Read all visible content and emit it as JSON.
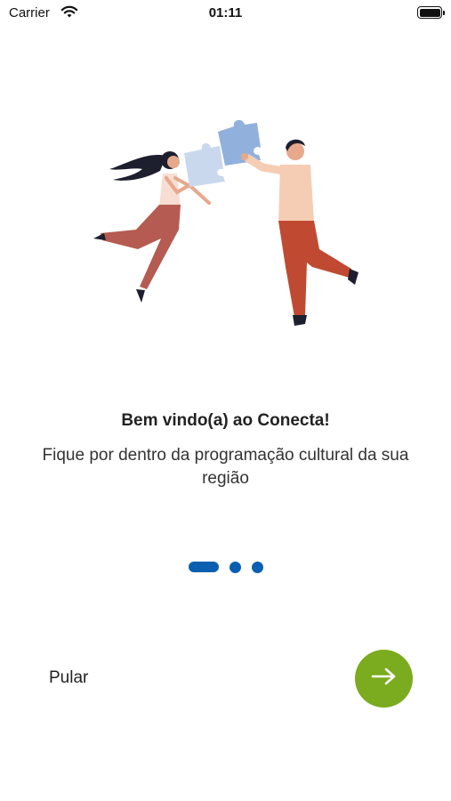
{
  "status_bar": {
    "carrier": "Carrier",
    "time": "01:11",
    "wifi_icon": "wifi-icon",
    "battery_icon": "battery-icon"
  },
  "onboarding": {
    "illustration": "people-puzzle-illustration",
    "title": "Bem vindo(a) ao Conecta!",
    "subtitle": "Fique por dentro da programação cultural da sua região",
    "page_indicator": {
      "current": 1,
      "total": 3
    },
    "skip_label": "Pular",
    "next_icon": "arrow-right-icon"
  },
  "colors": {
    "accent_blue": "#0b5fb0",
    "next_button_green": "#7bab1e"
  }
}
